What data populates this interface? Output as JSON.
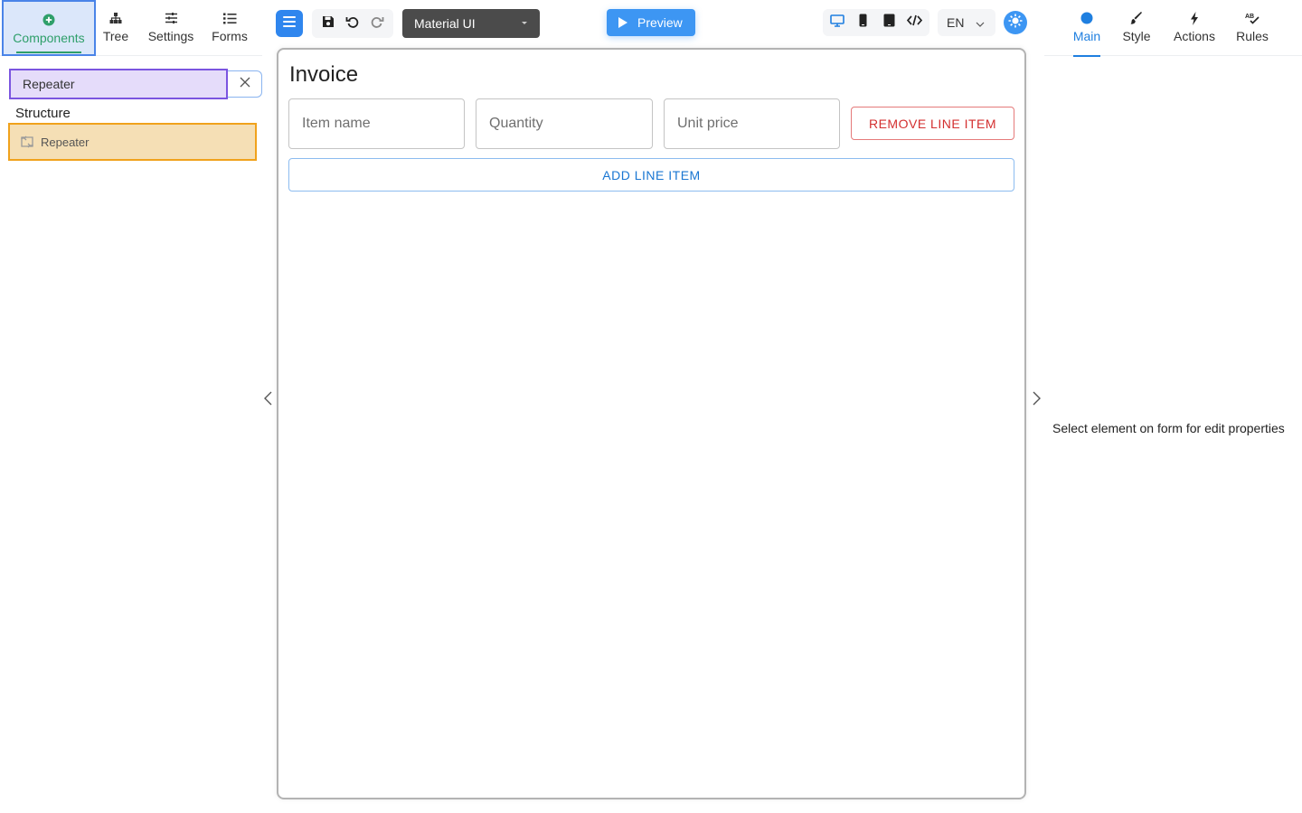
{
  "left_tabs": {
    "components": "Components",
    "tree": "Tree",
    "settings": "Settings",
    "forms": "Forms"
  },
  "search": {
    "value": "Repeater",
    "placeholder": ""
  },
  "structure": {
    "title": "Structure",
    "items": [
      {
        "label": "Repeater",
        "icon": "repeater-icon"
      }
    ]
  },
  "toolbar": {
    "theme_value": "Material UI",
    "preview_label": "Preview",
    "language": "EN"
  },
  "form": {
    "title": "Invoice",
    "fields": [
      {
        "placeholder": "Item name"
      },
      {
        "placeholder": "Quantity"
      },
      {
        "placeholder": "Unit price"
      }
    ],
    "remove_label": "REMOVE LINE ITEM",
    "add_label": "ADD LINE ITEM"
  },
  "right_tabs": {
    "main": "Main",
    "style": "Style",
    "actions": "Actions",
    "rules": "Rules"
  },
  "properties": {
    "empty_message": "Select element on form for edit properties"
  },
  "colors": {
    "accent_green": "#2e9f6a",
    "accent_blue": "#3d96f3",
    "danger": "#d32f2f",
    "selection_purple": "#7b55e0",
    "highlight_orange": "#f0a21c"
  }
}
